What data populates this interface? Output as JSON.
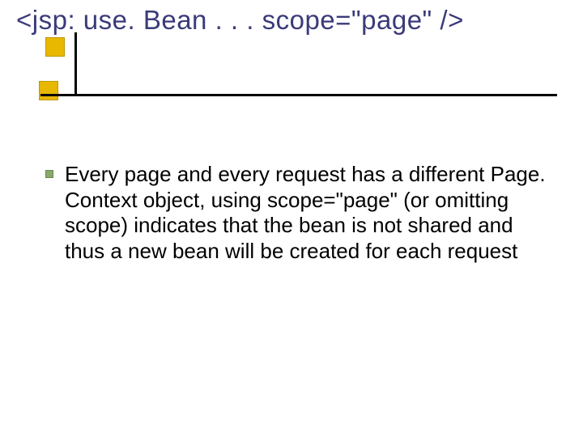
{
  "title": "<jsp: use. Bean . . . scope=\"page\" />",
  "body": {
    "bullets": [
      {
        "text": "Every page and every request has a different Page. Context object, using scope=\"page\" (or omitting scope) indicates that the bean is not shared and thus a new bean will be created for each request"
      }
    ]
  }
}
